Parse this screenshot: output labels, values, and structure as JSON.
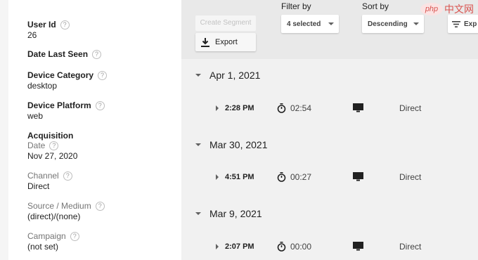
{
  "user": {
    "user_id_label": "User Id",
    "user_id_value": "26",
    "date_last_seen_label": "Date Last Seen",
    "device_category_label": "Device Category",
    "device_category_value": "desktop",
    "device_platform_label": "Device Platform",
    "device_platform_value": "web",
    "acquisition_label": "Acquisition",
    "date_label": "Date",
    "date_value": "Nov 27, 2020",
    "channel_label": "Channel",
    "channel_value": "Direct",
    "source_medium_label": "Source / Medium",
    "source_medium_value": "(direct)/(none)",
    "campaign_label": "Campaign",
    "campaign_value": "(not set)",
    "help_glyph": "?"
  },
  "toolbar": {
    "create_segment_label": "Create Segment",
    "export_label": "Export",
    "filter_by_label": "Filter by",
    "filter_value": "4 selected",
    "sort_by_label": "Sort by",
    "sort_value": "Descending",
    "export2_label": "Exp"
  },
  "days": [
    {
      "date": "Apr 1, 2021",
      "sessions": [
        {
          "time": "2:28 PM",
          "duration": "02:54",
          "channel": "Direct",
          "device_icon": "desktop-icon"
        }
      ]
    },
    {
      "date": "Mar 30, 2021",
      "sessions": [
        {
          "time": "4:51 PM",
          "duration": "00:27",
          "channel": "Direct",
          "device_icon": "desktop-icon"
        }
      ]
    },
    {
      "date": "Mar 9, 2021",
      "sessions": [
        {
          "time": "2:07 PM",
          "duration": "00:00",
          "channel": "Direct",
          "device_icon": "desktop-icon"
        }
      ]
    }
  ],
  "watermark": {
    "php": "php",
    "cn": "中文网"
  }
}
